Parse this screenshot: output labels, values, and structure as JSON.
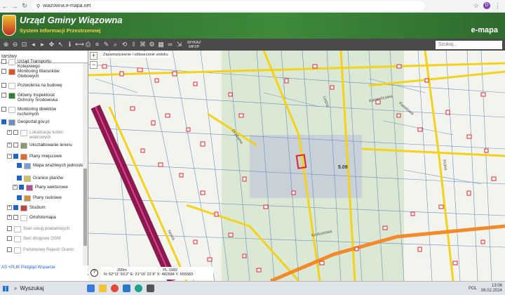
{
  "browser": {
    "url": "wiazowna.e-mapa.net",
    "profile_letter": "D"
  },
  "header": {
    "title": "Urząd Gminy Wiązowna",
    "subtitle": "System Informacji Przestrzennej",
    "brand": "e-mapa",
    "colors": {
      "bar": "#3e8a3a",
      "subtitle": "#f4d54a"
    }
  },
  "toolbar": {
    "icons": [
      "zoom-in-icon",
      "zoom-out-icon",
      "zoom-window-icon",
      "zoom-previous-icon",
      "zoom-next-icon",
      "pan-icon",
      "arrow-icon",
      "info-icon",
      "measure-icon",
      "print-icon",
      "layers-icon",
      "draw-icon",
      "search-icon",
      "history-icon",
      "share-icon",
      "tag-icon",
      "settings-icon",
      "grid-icon",
      "link-icon",
      "export-icon"
    ],
    "wykaz_line1": "WYKAZ",
    "wykaz_line2": "MPZP",
    "search_placeholder": "Szukaj..."
  },
  "sidebar": {
    "tab_label": "tarstwy",
    "layers": [
      {
        "label": "Urząd Transportu Kolejowego",
        "checked": false,
        "expand": "",
        "color": "#ffffff",
        "dim": false
      },
      {
        "label": "Monitoring Warunków Glebowych",
        "checked": false,
        "expand": "",
        "color": "#e05020",
        "dim": false
      },
      {
        "label": "Pozwolenia na budowę",
        "checked": false,
        "expand": "",
        "color": "#ffffff",
        "dim": false
      },
      {
        "label": "Główny Inspektorat Ochrony Środowiska",
        "checked": false,
        "expand": "",
        "color": "#2e7d32",
        "dim": false
      },
      {
        "label": "Monitoring obiektów ruchomych",
        "checked": false,
        "expand": "",
        "color": "#ffffff",
        "dim": false
      },
      {
        "label": "Geoportal.gov.pl",
        "checked": true,
        "expand": "",
        "color": "#6a8fbf",
        "dim": false
      },
      {
        "label": "Lokalizacja turbin wiatrowych",
        "checked": false,
        "expand": "+",
        "color": "#ffffff",
        "dim": true
      },
      {
        "label": "Ukształtowanie terenu",
        "checked": false,
        "expand": "+",
        "color": "#8a9a6a",
        "dim": false
      },
      {
        "label": "Plany miejscowe",
        "checked": true,
        "expand": "−",
        "color": "#e06a30",
        "dim": false
      },
      {
        "label": "Mapa wrażliwych jednostek",
        "checked": true,
        "expand": "",
        "color": "#7aa0d0",
        "dim": false
      },
      {
        "label": "Granice planów",
        "checked": true,
        "expand": "",
        "color": "#d0c060",
        "dim": false
      },
      {
        "label": "Plany wektorowe",
        "checked": true,
        "expand": "+",
        "color": "#b05090",
        "dim": false
      },
      {
        "label": "Plany rastrowe",
        "checked": true,
        "expand": "",
        "color": "#d09040",
        "dim": false
      },
      {
        "label": "Studium",
        "checked": true,
        "expand": "+",
        "color": "#c04040",
        "dim": false
      },
      {
        "label": "Ortofotomapa",
        "checked": false,
        "expand": "+",
        "color": "#ffffff",
        "dim": false
      },
      {
        "label": "Stan usług powiatowych",
        "checked": false,
        "expand": "",
        "color": "#ffffff",
        "dim": true
      },
      {
        "label": "Sieć drogowa OSM",
        "checked": false,
        "expand": "",
        "color": "#ffffff",
        "dim": true
      },
      {
        "label": "Państwowy Rejestr Granic",
        "checked": false,
        "expand": "",
        "color": "#ffffff",
        "dim": true
      }
    ],
    "footer": "AS  +PLIK  Podgląd  Wsparcie"
  },
  "map": {
    "title": "Zapamiętywanie i odtwarzanie widoku",
    "scale_label": "200m",
    "scale_code": "PL-1992",
    "coords": "N: 52°11' 50.2\"  E: 21°16' 22.9\"  X: 482684  Y: 655583",
    "parcel_label": "5.09",
    "street_labels": [
      {
        "text": "Krokusowa"
      },
      {
        "text": "Kaczeńcowa"
      },
      {
        "text": "Drzewna"
      },
      {
        "text": "Leśna"
      },
      {
        "text": "Kwiatowa"
      },
      {
        "text": "Nowa"
      },
      {
        "text": "Polna"
      }
    ],
    "colors": {
      "road_main": "#f2d21a",
      "railway": "#8a1a4a",
      "parcel": "#e0232b",
      "orange_road": "#f28a2a"
    }
  },
  "taskbar": {
    "search_label": "Wyszukaj",
    "lang": "POL",
    "time": "13:06",
    "date": "06.02.2024"
  }
}
